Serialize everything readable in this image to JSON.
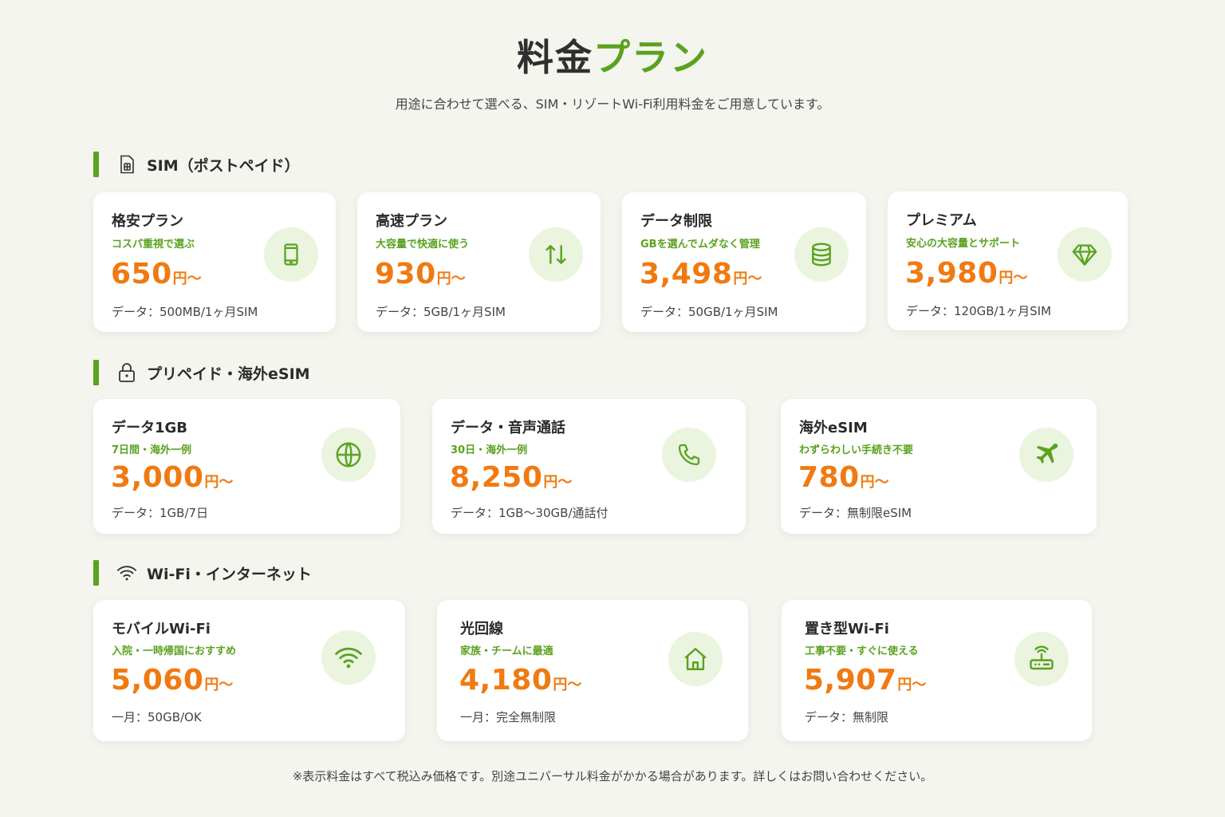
{
  "header": {
    "title_main": "料金",
    "title_accent": "プラン",
    "subtitle": "用途に合わせて選べる、SIM・リゾートWi-Fi利用料金をご用意しています。"
  },
  "colors": {
    "accent_green": "#5aa21f",
    "price_orange": "#f07a12",
    "icon_bg": "#eaf4df"
  },
  "sections": [
    {
      "title": "SIM（ポストペイド）",
      "icon": "sim-card-icon",
      "cards": [
        {
          "name": "格安プラン",
          "tag": "コスパ重視で選ぶ",
          "price": "650",
          "unit": "円～",
          "detail": "データ：500MB/1ヶ月SIM",
          "icon": "smartphone-icon"
        },
        {
          "name": "高速プラン",
          "tag": "大容量で快適に使う",
          "price": "930",
          "unit": "円～",
          "detail": "データ：5GB/1ヶ月SIM",
          "icon": "up-down-arrows-icon"
        },
        {
          "name": "データ制限",
          "tag": "GBを選んでムダなく管理",
          "price": "3,498",
          "unit": "円～",
          "detail": "データ：50GB/1ヶ月SIM",
          "icon": "database-icon"
        },
        {
          "name": "プレミアム",
          "tag": "安心の大容量とサポート",
          "price": "3,980",
          "unit": "円～",
          "detail": "データ：120GB/1ヶ月SIM",
          "icon": "diamond-icon"
        }
      ]
    },
    {
      "title": "プリペイド・海外eSIM",
      "icon": "lock-icon",
      "cards": [
        {
          "name": "データ1GB",
          "tag": "7日間・海外一例",
          "price": "3,000",
          "unit": "円～",
          "detail": "データ：1GB/7日",
          "icon": "globe-icon"
        },
        {
          "name": "データ・音声通話",
          "tag": "30日・海外一例",
          "price": "8,250",
          "unit": "円～",
          "detail": "データ：1GB～30GB/通話付",
          "icon": "phone-icon"
        },
        {
          "name": "海外eSIM",
          "tag": "わずらわしい手続き不要",
          "price": "780",
          "unit": "円～",
          "detail": "データ：無制限eSIM",
          "icon": "airplane-icon"
        }
      ]
    },
    {
      "title": "Wi-Fi・インターネット",
      "icon": "wifi-icon",
      "cards": [
        {
          "name": "モバイルWi-Fi",
          "tag": "入院・一時帰国におすすめ",
          "price": "5,060",
          "unit": "円～",
          "detail": "一月：50GB/OK",
          "icon": "wifi-icon"
        },
        {
          "name": "光回線",
          "tag": "家族・チームに最適",
          "price": "4,180",
          "unit": "円～",
          "detail": "一月：完全無制限",
          "icon": "house-icon"
        },
        {
          "name": "置き型Wi-Fi",
          "tag": "工事不要・すぐに使える",
          "price": "5,907",
          "unit": "円～",
          "detail": "データ：無制限",
          "icon": "router-icon"
        }
      ]
    }
  ],
  "footnote": "※表示料金はすべて税込み価格です。別途ユニバーサル料金がかかる場合があります。詳しくはお問い合わせください。"
}
